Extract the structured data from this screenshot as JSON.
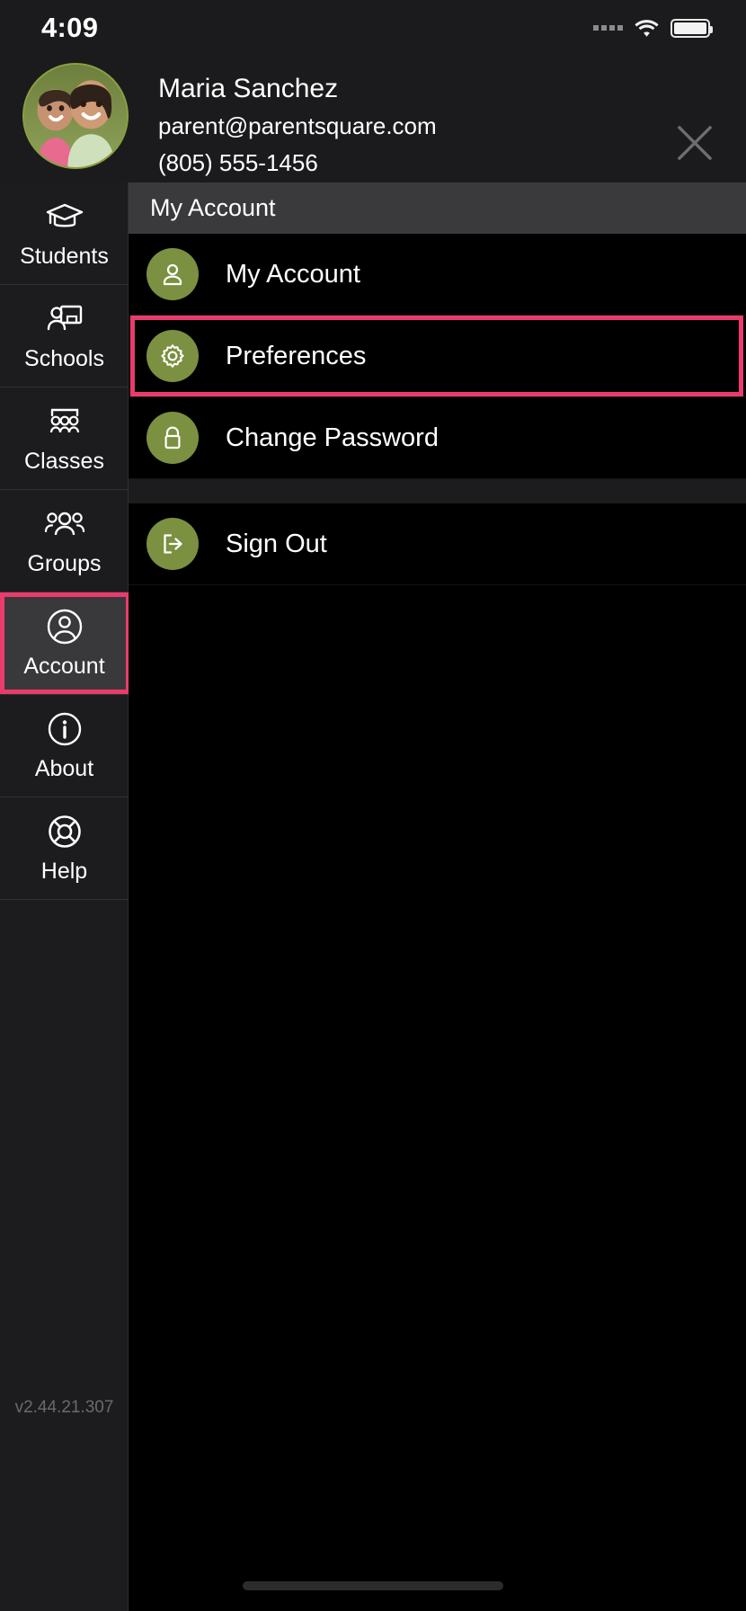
{
  "status_bar": {
    "time": "4:09",
    "signal_icon": "signal-dots-icon",
    "wifi_icon": "wifi-icon",
    "battery_icon": "battery-icon"
  },
  "profile": {
    "avatar_icon": "user-avatar-photo",
    "name": "Maria Sanchez",
    "email": "parent@parentsquare.com",
    "phone": "(805) 555-1456",
    "close_icon": "close-icon"
  },
  "sidebar": {
    "items": [
      {
        "label": "Students",
        "icon": "graduation-cap-icon",
        "selected": false
      },
      {
        "label": "Schools",
        "icon": "school-presentation-icon",
        "selected": false
      },
      {
        "label": "Classes",
        "icon": "classroom-people-icon",
        "selected": false
      },
      {
        "label": "Groups",
        "icon": "group-people-icon",
        "selected": false
      },
      {
        "label": "Account",
        "icon": "account-circle-icon",
        "selected": true
      },
      {
        "label": "About",
        "icon": "info-circle-icon",
        "selected": false
      },
      {
        "label": "Help",
        "icon": "lifebuoy-icon",
        "selected": false
      }
    ],
    "version": "v2.44.21.307"
  },
  "content": {
    "header_title": "My Account",
    "groups": [
      {
        "rows": [
          {
            "label": "My Account",
            "icon": "person-icon",
            "highlighted": false
          },
          {
            "label": "Preferences",
            "icon": "gear-icon",
            "highlighted": true
          },
          {
            "label": "Change Password",
            "icon": "lock-icon",
            "highlighted": false
          }
        ]
      },
      {
        "rows": [
          {
            "label": "Sign Out",
            "icon": "sign-out-icon",
            "highlighted": false
          }
        ]
      }
    ]
  },
  "colors": {
    "accent_highlight": "#ea3b6d",
    "icon_green": "#7b9040",
    "panel_dark": "#1c1c1e",
    "header_gray": "#3a3a3c",
    "background": "#000000"
  },
  "home_indicator": "home-indicator"
}
